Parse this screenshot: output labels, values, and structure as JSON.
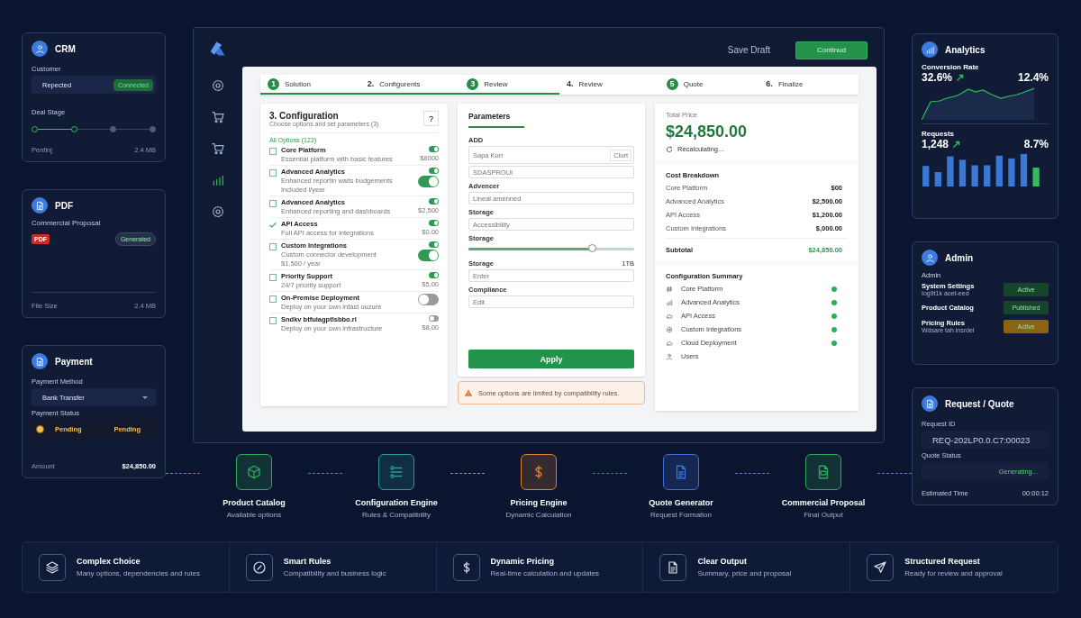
{
  "crm": {
    "title": "CRM",
    "customer_label": "Customer",
    "customer": "Repected",
    "customer_status": "Connected",
    "stage_label": "Deal Stage",
    "stages": [
      {
        "done": true
      },
      {
        "done": true
      },
      {
        "done": false
      },
      {
        "done": false
      }
    ],
    "footer_label": "Penfinj",
    "footer_value": "2.4 MB"
  },
  "pdf": {
    "title": "PDF",
    "document": "Commercial Proposal",
    "file_badge": "PDF",
    "status": "Generated",
    "size_label": "File Size",
    "size": "2.4 MB"
  },
  "payment": {
    "title": "Payment",
    "method_label": "Payment Method",
    "method": "Bank Transfer",
    "status_label": "Payment Status",
    "status": "Pending",
    "status_value": "Pending",
    "amount_label": "Amount",
    "amount": "$24,850.00"
  },
  "window": {
    "save_draft": "Save Draft",
    "continue": "Continud"
  },
  "sidebar": [
    {
      "kind": "gear",
      "selected": false
    },
    {
      "kind": "cart",
      "selected": false
    },
    {
      "kind": "cart",
      "selected": false
    },
    {
      "kind": "chart",
      "selected": true
    },
    {
      "kind": "gear",
      "selected": false
    }
  ],
  "steps": [
    {
      "number": "1",
      "label": "Solution",
      "kind": "circle",
      "done": true
    },
    {
      "number": "2.",
      "label": "Configurents",
      "kind": "plain",
      "done": true
    },
    {
      "number": "3",
      "label": "Review",
      "kind": "circle",
      "done": true
    },
    {
      "number": "4.",
      "label": "Review",
      "kind": "plain",
      "done": false
    },
    {
      "number": "5",
      "label": "Quote",
      "kind": "circle",
      "done": false
    },
    {
      "number": "6.",
      "label": "Finalize",
      "kind": "plain",
      "done": false
    }
  ],
  "config": {
    "title": "3. Configuration",
    "subtitle": "Choose options and set parameters (3)",
    "help": "?",
    "count": "All Options (122)",
    "items": [
      {
        "kind": "box",
        "checked": false,
        "title": "Core Platform",
        "description": "Essential platform with basic features",
        "price": "$8000",
        "toggles": [
          {
            "kind": "small",
            "on": true
          }
        ]
      },
      {
        "kind": "box",
        "checked": false,
        "title": "Advanced Analytics",
        "description": "Enhanced reportin waits budgements",
        "note": "Included i/year",
        "toggles": [
          {
            "kind": "small",
            "on": true
          },
          {
            "kind": "large",
            "on": true
          }
        ]
      },
      {
        "kind": "box",
        "checked": false,
        "title": "Advanced Analytics",
        "description": "Enhanced reporting and dashboards",
        "price": "$2,500",
        "toggles": [
          {
            "kind": "small",
            "on": true
          }
        ]
      },
      {
        "kind": "check",
        "title": "API Access",
        "description": "Full API access for integrations",
        "price": "$0.00",
        "toggles": [
          {
            "kind": "small",
            "on": true
          }
        ]
      },
      {
        "kind": "box",
        "checked": false,
        "title": "Custom Integrations",
        "description": "Custom connector development",
        "note": "$1,500 / year",
        "toggles": [
          {
            "kind": "small",
            "on": true
          },
          {
            "kind": "large",
            "on": true
          }
        ]
      },
      {
        "kind": "box",
        "checked": false,
        "title": "Priority Support",
        "description": "24/7 priority support",
        "price": "$5,00",
        "toggles": [
          {
            "kind": "small",
            "on": true
          }
        ]
      },
      {
        "kind": "box",
        "checked": false,
        "title": "On-Premise Deployment",
        "description": "Deploy on your own infast ouzure",
        "toggles": [
          {
            "kind": "large",
            "on": false
          }
        ]
      },
      {
        "kind": "box",
        "checked": false,
        "title": "Sndkv btfulagptlsbbo.rl",
        "description": "Deploy on your own infrastructure",
        "price": "$8,00",
        "toggles": [
          {
            "kind": "small",
            "on": false
          }
        ]
      }
    ]
  },
  "parameters": {
    "title": "Parameters",
    "fields": [
      {
        "kind": "input",
        "label": "ADD",
        "placeholder": "Sapa Kurr",
        "action": "Clurt"
      },
      {
        "kind": "input",
        "placeholder": "SDASPROUI"
      },
      {
        "kind": "input",
        "label": "Advencer",
        "placeholder": "Lineal amenned"
      },
      {
        "kind": "input",
        "label": "Storage",
        "placeholder": "Accessibility"
      },
      {
        "kind": "slider",
        "label": "Storage",
        "level": 0.75
      },
      {
        "kind": "input",
        "label": "Storage",
        "value": "1TB",
        "placeholder": "Enter"
      },
      {
        "kind": "input",
        "label": "Compliance",
        "placeholder": "Edit"
      }
    ],
    "apply": "Apply",
    "warning": "Some options are limited by compatibility rules."
  },
  "price": {
    "total_label": "Total Price",
    "total": "$24,850.00",
    "status": "Recalculating...",
    "breakdown_title": "Cost Breakdown",
    "rows": [
      {
        "label": "Core Platform",
        "value": "$00"
      },
      {
        "label": "Advanced Analytics",
        "value": "$2,500.00"
      },
      {
        "label": "API Access",
        "value": "$1,200.00"
      },
      {
        "label": "Custom Integrations",
        "value": "$,000.00"
      }
    ],
    "subtotal_label": "Subtotal",
    "subtotal": "$24,850.00",
    "summary_title": "Configuration Summary",
    "summary": [
      {
        "kind": "hash",
        "label": "Core Platform",
        "checked": true
      },
      {
        "kind": "bars",
        "label": "Advanced Analytics",
        "checked": true
      },
      {
        "kind": "cloud",
        "label": "API Access",
        "checked": true
      },
      {
        "kind": "gear",
        "label": "Custom Integrations",
        "checked": true
      },
      {
        "kind": "cloud",
        "label": "Cloud Deployment",
        "checked": true
      },
      {
        "kind": "user",
        "label": "Users",
        "checked": false
      }
    ]
  },
  "analytics": {
    "title": "Analytics",
    "metrics": [
      {
        "kind": "line",
        "label": "Conversion Rate",
        "value": "32.6%",
        "trend": "12.4%"
      },
      {
        "kind": "bars",
        "label": "Requests",
        "value": "1,248",
        "trend": "8.7%"
      }
    ]
  },
  "admin": {
    "title": "Admin",
    "subtitle": "Admin",
    "rows": [
      {
        "label": "System Settings",
        "note": "Iog9t1k aoet-eed",
        "status": "Active",
        "color": "#17452c"
      },
      {
        "label": "Product Catalog",
        "status": "Published",
        "color": "#17452c"
      },
      {
        "label": "Pricing Rules",
        "note": "Wdsare tah insrdel",
        "status": "Active",
        "color": "#8a6410"
      }
    ]
  },
  "request": {
    "title": "Request / Quote",
    "id_label": "Request ID",
    "id": "REQ-202LP0.0.C7:00023",
    "status_label": "Quote Status",
    "status": "Generating...",
    "time_label": "Estimated Time",
    "time": "00:00:12"
  },
  "flow": [
    {
      "kind": "box",
      "title": "Product Catalog",
      "subtitle": "Available options",
      "color": "#2fa85a"
    },
    {
      "kind": "list",
      "title": "Configuration Engine",
      "subtitle": "Rules & Compatibility",
      "color": "#2a9d8f"
    },
    {
      "kind": "dollar",
      "title": "Pricing Engine",
      "subtitle": "Dynamic Calculation",
      "color": "#d9822b"
    },
    {
      "kind": "doc",
      "title": "Quote Generator",
      "subtitle": "Request Formation",
      "color": "#3b6fd8"
    },
    {
      "kind": "pdf",
      "title": "Commercial Proposal",
      "subtitle": "Final Output",
      "color": "#2fa85a"
    }
  ],
  "features": [
    {
      "kind": "layers",
      "title": "Complex Choice",
      "text": "Many options, dependencies and rules"
    },
    {
      "kind": "check",
      "title": "Smart Rules",
      "text": "Compatibility and business logic"
    },
    {
      "kind": "dollar",
      "title": "Dynamic Pricing",
      "text": "Real-time calculation and updates"
    },
    {
      "kind": "doc",
      "title": "Clear Output",
      "text": "Summary, price and proposal"
    },
    {
      "kind": "send",
      "title": "Structured Request",
      "text": "Ready for review and approval"
    }
  ]
}
